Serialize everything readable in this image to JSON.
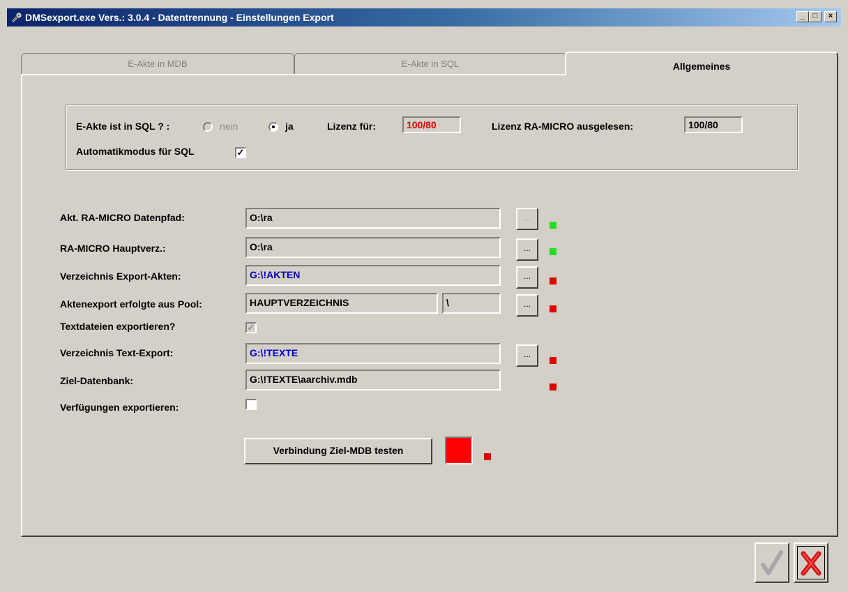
{
  "window": {
    "title": "DMSexport.exe Vers.: 3.0.4 - Datentrennung - Einstellungen Export",
    "minimize_symbol": "_",
    "maximize_symbol": "□",
    "close_symbol": "×"
  },
  "tabs": [
    {
      "label": "E-Akte in MDB",
      "active": false
    },
    {
      "label": "E-Akte in SQL",
      "active": false
    },
    {
      "label": "Allgemeines",
      "active": true
    }
  ],
  "sql_group": {
    "question_label": "E-Akte ist in SQL ? :",
    "option_nein": "nein",
    "option_ja": "ja",
    "selected": "ja",
    "lizenz_label": "Lizenz für:",
    "lizenz_value": "100/80",
    "lizenz_ra_label": "Lizenz RA-MICRO ausgelesen:",
    "lizenz_ra_value": "100/80",
    "automatik_label": "Automatikmodus für SQL",
    "automatik_checked": true,
    "check_glyph": "✓"
  },
  "fields": {
    "datenpfad_label": "Akt. RA-MICRO Datenpfad:",
    "datenpfad_value": "O:\\ra",
    "hauptverz_label": "RA-MICRO Hauptverz.:",
    "hauptverz_value": "O:\\ra",
    "export_akten_label": "Verzeichnis Export-Akten:",
    "export_akten_value": "G:\\!AKTEN",
    "pool_label": "Aktenexport erfolgte aus Pool:",
    "pool_value": "HAUPTVERZEICHNIS",
    "pool_suffix": "\\",
    "textdateien_label": "Textdateien exportieren?",
    "text_export_label": "Verzeichnis Text-Export:",
    "text_export_value": "G:\\!TEXTE",
    "ziel_db_label": "Ziel-Datenbank:",
    "ziel_db_value": "G:\\!TEXTE\\aarchiv.mdb",
    "verfuegungen_label": "Verfügungen exportieren:",
    "browse_label": "...",
    "check_glyph": "✓"
  },
  "colors": {
    "ok_indicator": "#22dd22",
    "error_indicator": "#e00000",
    "path_blue": "#0000c0"
  },
  "test_button": {
    "label": "Verbindung Ziel-MDB testen"
  },
  "icons": {
    "title": "wrench-icon",
    "ok": "checkmark-icon",
    "cancel": "cross-icon"
  }
}
